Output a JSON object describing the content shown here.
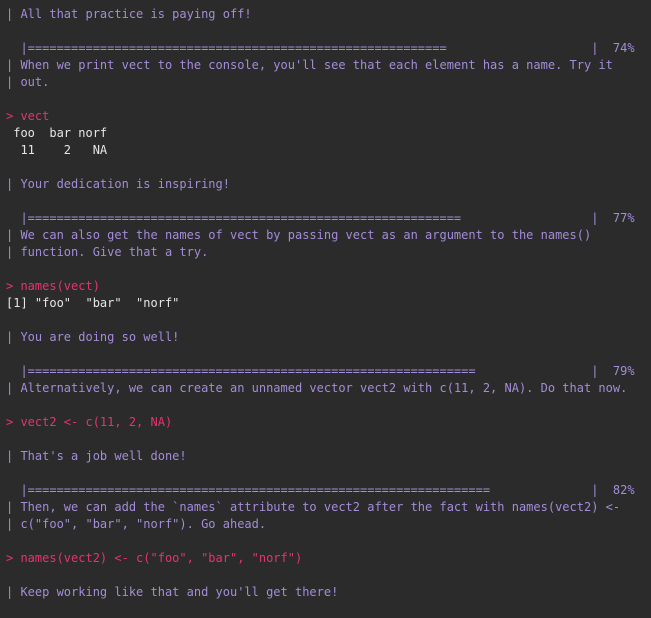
{
  "colors": {
    "background": "#2b2b2b",
    "message": "#a48cd8",
    "command": "#e6336e",
    "output": "#e6e6e6"
  },
  "lines": [
    {
      "type": "msg",
      "text": "| All that practice is paying off!"
    },
    {
      "type": "blank",
      "text": ""
    },
    {
      "type": "prog",
      "text": "  |==========================================================                    |  74%"
    },
    {
      "type": "msg",
      "text": "| When we print vect to the console, you'll see that each element has a name. Try it"
    },
    {
      "type": "msg",
      "text": "| out."
    },
    {
      "type": "blank",
      "text": ""
    },
    {
      "type": "cmd",
      "text": "> vect"
    },
    {
      "type": "out",
      "text": " foo  bar norf"
    },
    {
      "type": "out",
      "text": "  11    2   NA"
    },
    {
      "type": "blank",
      "text": ""
    },
    {
      "type": "msg",
      "text": "| Your dedication is inspiring!"
    },
    {
      "type": "blank",
      "text": ""
    },
    {
      "type": "prog",
      "text": "  |============================================================                  |  77%"
    },
    {
      "type": "msg",
      "text": "| We can also get the names of vect by passing vect as an argument to the names()"
    },
    {
      "type": "msg",
      "text": "| function. Give that a try."
    },
    {
      "type": "blank",
      "text": ""
    },
    {
      "type": "cmd",
      "text": "> names(vect)"
    },
    {
      "type": "out",
      "text": "[1] \"foo\"  \"bar\"  \"norf\""
    },
    {
      "type": "blank",
      "text": ""
    },
    {
      "type": "msg",
      "text": "| You are doing so well!"
    },
    {
      "type": "blank",
      "text": ""
    },
    {
      "type": "prog",
      "text": "  |==============================================================                |  79%"
    },
    {
      "type": "msg",
      "text": "| Alternatively, we can create an unnamed vector vect2 with c(11, 2, NA). Do that now."
    },
    {
      "type": "blank",
      "text": ""
    },
    {
      "type": "cmd",
      "text": "> vect2 <- c(11, 2, NA)"
    },
    {
      "type": "blank",
      "text": ""
    },
    {
      "type": "msg",
      "text": "| That's a job well done!"
    },
    {
      "type": "blank",
      "text": ""
    },
    {
      "type": "prog",
      "text": "  |================================================================              |  82%"
    },
    {
      "type": "msg",
      "text": "| Then, we can add the `names` attribute to vect2 after the fact with names(vect2) <-"
    },
    {
      "type": "msg",
      "text": "| c(\"foo\", \"bar\", \"norf\"). Go ahead."
    },
    {
      "type": "blank",
      "text": ""
    },
    {
      "type": "cmd",
      "text": "> names(vect2) <- c(\"foo\", \"bar\", \"norf\")"
    },
    {
      "type": "blank",
      "text": ""
    },
    {
      "type": "msg",
      "text": "| Keep working like that and you'll get there!"
    }
  ]
}
